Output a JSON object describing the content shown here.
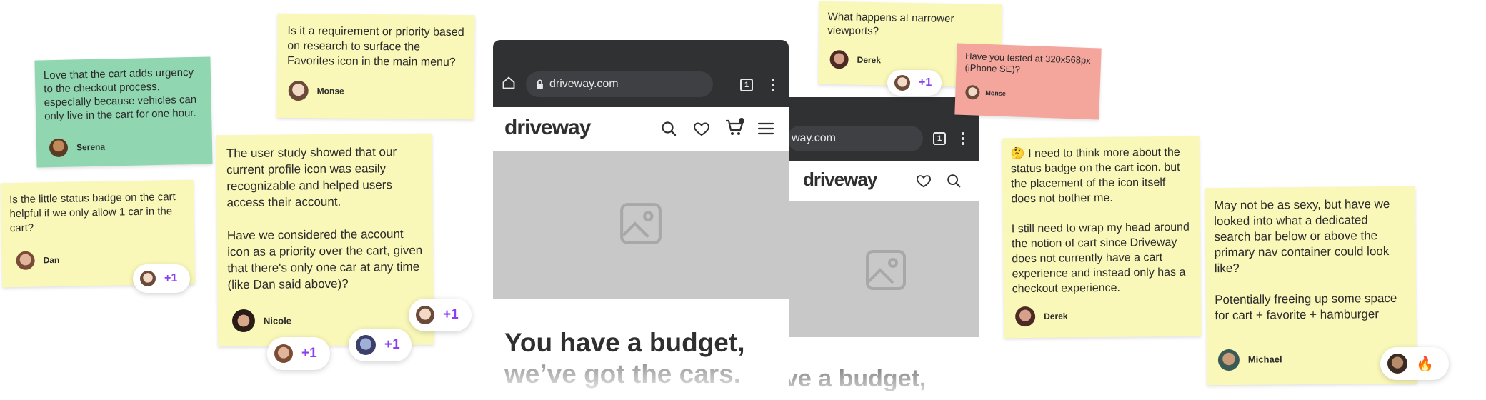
{
  "notes": {
    "serena": {
      "text": "Love that the cart adds urgency to the checkout process, especially because vehicles can only live in the cart for one hour.",
      "author": "Serena"
    },
    "dan": {
      "text": "Is the little status badge on the cart helpful if we only allow 1 car in the cart?",
      "author": "Dan"
    },
    "monse": {
      "text": "Is it a requirement or priority based on research to surface the Favorites icon in the main menu?",
      "author": "Monse"
    },
    "nicole": {
      "text": "The user study showed that our current profile icon was easily recognizable and helped users access their account.\n\nHave we considered the account icon as a priority over the cart, given that there's only one car at any time (like Dan said above)?",
      "author": "Nicole"
    },
    "derek_top": {
      "text": "What happens at narrower viewports?",
      "author": "Derek"
    },
    "monse_red": {
      "text": "Have you tested at 320x568px (iPhone SE)?",
      "author": "Monse"
    },
    "derek": {
      "text": "🤔 I need to think more about the status badge on the cart icon. but the placement of the icon itself does not bother me.\n\nI still need to wrap my head around the notion of cart since Driveway does not currently have a cart experience and instead only has a checkout experience.",
      "author": "Derek"
    },
    "michael": {
      "text": "May not be as sexy, but have we looked into what a dedicated search bar below or above the primary nav container could look like?\n\nPotentially freeing up some space for cart + favorite + hamburger",
      "author": "Michael"
    }
  },
  "reactions": {
    "plus": "+1",
    "fire": "🔥"
  },
  "phone_main": {
    "url": "driveway.com",
    "tab_count": "1",
    "brand": "driveway",
    "hero_line1": "You have a budget,",
    "hero_line2": "we’ve got the cars."
  },
  "phone_back": {
    "url": "way.com",
    "tab_count": "1",
    "brand": "driveway",
    "hero_line1": "ve a budget,"
  },
  "colors": {
    "note_yellow": "#f9f8b8",
    "note_green": "#8fd6b1",
    "note_red": "#f4a59c",
    "accent_purple": "#8a3ff0",
    "browser_bar": "#303133"
  }
}
